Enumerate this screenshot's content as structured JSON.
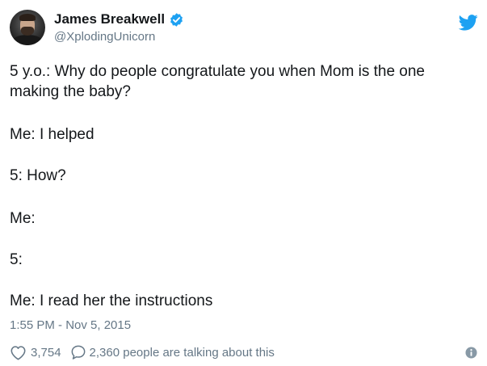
{
  "author": {
    "name": "James Breakwell",
    "handle": "@XplodingUnicorn",
    "verified": true
  },
  "tweet": {
    "lines": [
      "5 y.o.: Why do people congratulate you when Mom is the one",
      "making the baby?",
      "Me: I helped",
      "5: How?",
      "Me:",
      "5:",
      "Me: I read her the instructions"
    ],
    "timestamp": "1:55 PM - Nov 5, 2015"
  },
  "engagement": {
    "likes": "3,754",
    "replies_text": "2,360 people are talking about this"
  },
  "icons": {
    "verified": "verified-badge-icon",
    "brand": "twitter-bird-icon",
    "like": "heart-icon",
    "reply": "speech-bubble-icon",
    "info": "info-icon"
  },
  "colors": {
    "brand_blue": "#1da1f2",
    "text_primary": "#14171a",
    "text_secondary": "#657786"
  }
}
